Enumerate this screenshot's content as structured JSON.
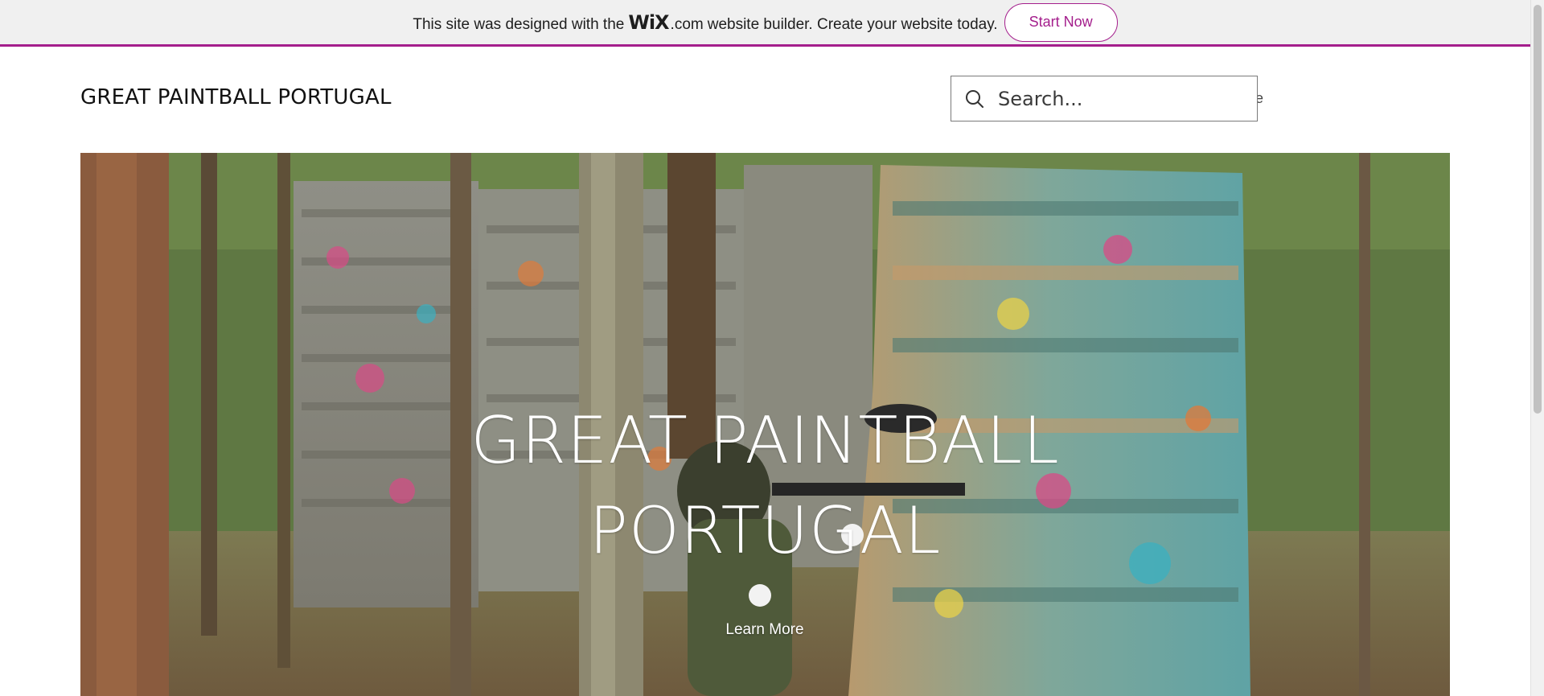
{
  "wix_banner": {
    "text_before": "This site was designed with the",
    "logo": "WiX",
    "dotcom": ".com",
    "text_after": "website builder. Create your website today.",
    "button_label": "Start Now",
    "accent_color": "#a41e8c"
  },
  "header": {
    "site_title": "GREAT PAINTBALL PORTUGAL",
    "nav_home_visible": "ome",
    "search": {
      "placeholder": "Search...",
      "icon": "search-icon"
    }
  },
  "hero": {
    "title_line1": "GREAT PAINTBALL",
    "title_line2": "PORTUGAL",
    "cta_label": "Learn More"
  }
}
